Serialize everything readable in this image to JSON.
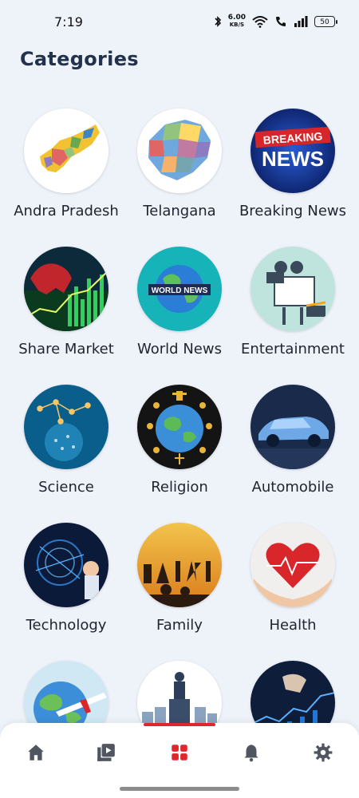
{
  "status_bar": {
    "time": "7:19",
    "net_speed_value": "6.00",
    "net_speed_unit": "KB/S",
    "battery": "50"
  },
  "page": {
    "title": "Categories"
  },
  "categories": [
    {
      "label": "Andra Pradesh",
      "image": "andhra-pradesh-map"
    },
    {
      "label": "Telangana",
      "image": "telangana-map"
    },
    {
      "label": "Breaking News",
      "image": "breaking-news-banner"
    },
    {
      "label": "Share Market",
      "image": "stock-market-bull"
    },
    {
      "label": "World News",
      "image": "world-news-globe"
    },
    {
      "label": "Entertainment",
      "image": "film-camera"
    },
    {
      "label": "Science",
      "image": "science-molecules"
    },
    {
      "label": "Religion",
      "image": "religion-globe-symbols"
    },
    {
      "label": "Automobile",
      "image": "futuristic-car"
    },
    {
      "label": "Technology",
      "image": "technology-child-hologram"
    },
    {
      "label": "Family",
      "image": "family-silhouette-sunset"
    },
    {
      "label": "Health",
      "image": "heart-in-hands"
    },
    {
      "label": "",
      "image": "travel-globe-airplane"
    },
    {
      "label": "",
      "image": "politics-speaker-podium"
    },
    {
      "label": "",
      "image": "business-chart-laptop"
    }
  ],
  "bottom_nav": {
    "items": [
      {
        "icon": "home-icon",
        "active": false
      },
      {
        "icon": "video-library-icon",
        "active": false
      },
      {
        "icon": "categories-grid-icon",
        "active": true
      },
      {
        "icon": "bell-icon",
        "active": false
      },
      {
        "icon": "gear-icon",
        "active": false
      }
    ],
    "active_color": "#e0262b",
    "inactive_color": "#505560"
  },
  "accent_color": "#e0262b"
}
